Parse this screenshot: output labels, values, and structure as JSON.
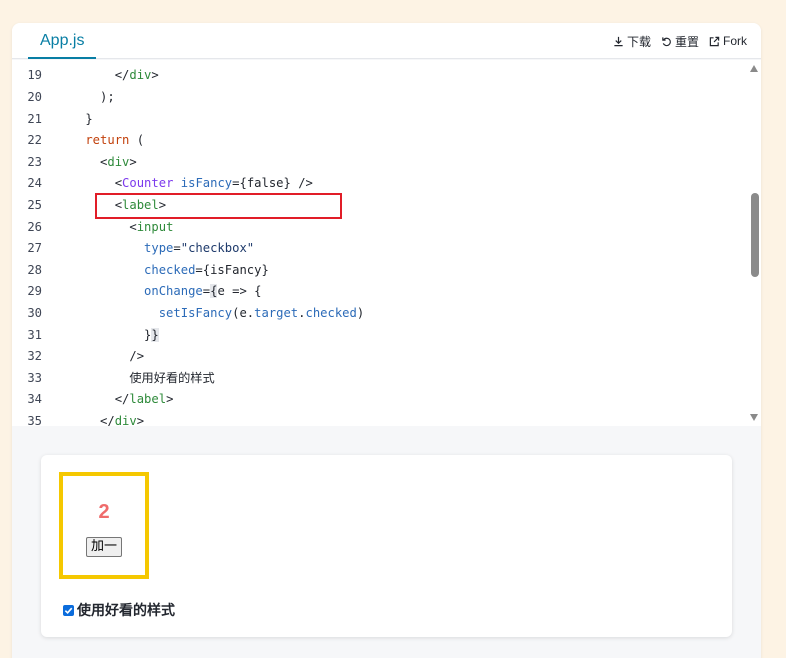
{
  "tab": {
    "label": "App.js"
  },
  "actions": [
    {
      "name": "download",
      "label": "下载",
      "icon": "download-icon"
    },
    {
      "name": "reset",
      "label": "重置",
      "icon": "reset-icon"
    },
    {
      "name": "fork",
      "label": "Fork",
      "icon": "external-link-icon"
    }
  ],
  "code_lines": [
    {
      "n": "19",
      "segs": [
        [
          "tg",
          "        </"
        ],
        [
          "tn",
          "div"
        ],
        [
          "tg",
          ">"
        ]
      ]
    },
    {
      "n": "20",
      "segs": [
        [
          "tg",
          "      );"
        ]
      ]
    },
    {
      "n": "21",
      "segs": [
        [
          "tg",
          "    }"
        ]
      ]
    },
    {
      "n": "22",
      "segs": [
        [
          "kw",
          "    return"
        ],
        [
          "tg",
          " ("
        ]
      ]
    },
    {
      "n": "23",
      "segs": [
        [
          "tg",
          "      <"
        ],
        [
          "tn",
          "div"
        ],
        [
          "tg",
          ">"
        ]
      ]
    },
    {
      "n": "24",
      "segs": [
        [
          "tg",
          "        <"
        ],
        [
          "cm",
          "Counter"
        ],
        [
          "tg",
          " "
        ],
        [
          "at",
          "isFancy"
        ],
        [
          "tg",
          "={"
        ],
        [
          "tg",
          "false"
        ],
        [
          "tg",
          "} />"
        ]
      ]
    },
    {
      "n": "25",
      "segs": [
        [
          "tg",
          "        <"
        ],
        [
          "tn",
          "label"
        ],
        [
          "tg",
          ">"
        ]
      ]
    },
    {
      "n": "26",
      "segs": [
        [
          "tg",
          "          <"
        ],
        [
          "tn",
          "input"
        ]
      ]
    },
    {
      "n": "27",
      "segs": [
        [
          "at",
          "            type"
        ],
        [
          "tg",
          "="
        ],
        [
          "st",
          "\"checkbox\""
        ]
      ]
    },
    {
      "n": "28",
      "segs": [
        [
          "at",
          "            checked"
        ],
        [
          "tg",
          "={isFancy}"
        ]
      ]
    },
    {
      "n": "29",
      "segs": [
        [
          "at",
          "            onChange"
        ],
        [
          "tg",
          "="
        ],
        [
          "hl",
          "{"
        ],
        [
          "tg",
          "e => {"
        ]
      ]
    },
    {
      "n": "30",
      "segs": [
        [
          "fn",
          "              setIsFancy"
        ],
        [
          "tg",
          "(e."
        ],
        [
          "at",
          "target"
        ],
        [
          "tg",
          "."
        ],
        [
          "at",
          "checked"
        ],
        [
          "tg",
          ")"
        ]
      ]
    },
    {
      "n": "31",
      "segs": [
        [
          "tg",
          "            }"
        ],
        [
          "hl",
          "}"
        ]
      ]
    },
    {
      "n": "32",
      "segs": [
        [
          "tg",
          "          />"
        ]
      ]
    },
    {
      "n": "33",
      "segs": [
        [
          "tg",
          "          使用好看的样式"
        ]
      ]
    },
    {
      "n": "34",
      "segs": [
        [
          "tg",
          "        </"
        ],
        [
          "tn",
          "label"
        ],
        [
          "tg",
          ">"
        ]
      ]
    },
    {
      "n": "35",
      "segs": [
        [
          "tg",
          "      </"
        ],
        [
          "tn",
          "div"
        ],
        [
          "tg",
          ">"
        ]
      ]
    }
  ],
  "preview": {
    "count": "2",
    "add_button": "加一",
    "checkbox_checked": true,
    "checkbox_label": "使用好看的样式"
  },
  "colors": {
    "accent": "#087ea4",
    "highlight_red": "#e11d28",
    "highlight_yellow": "#f5c800",
    "count_color": "#ef6b6b"
  }
}
